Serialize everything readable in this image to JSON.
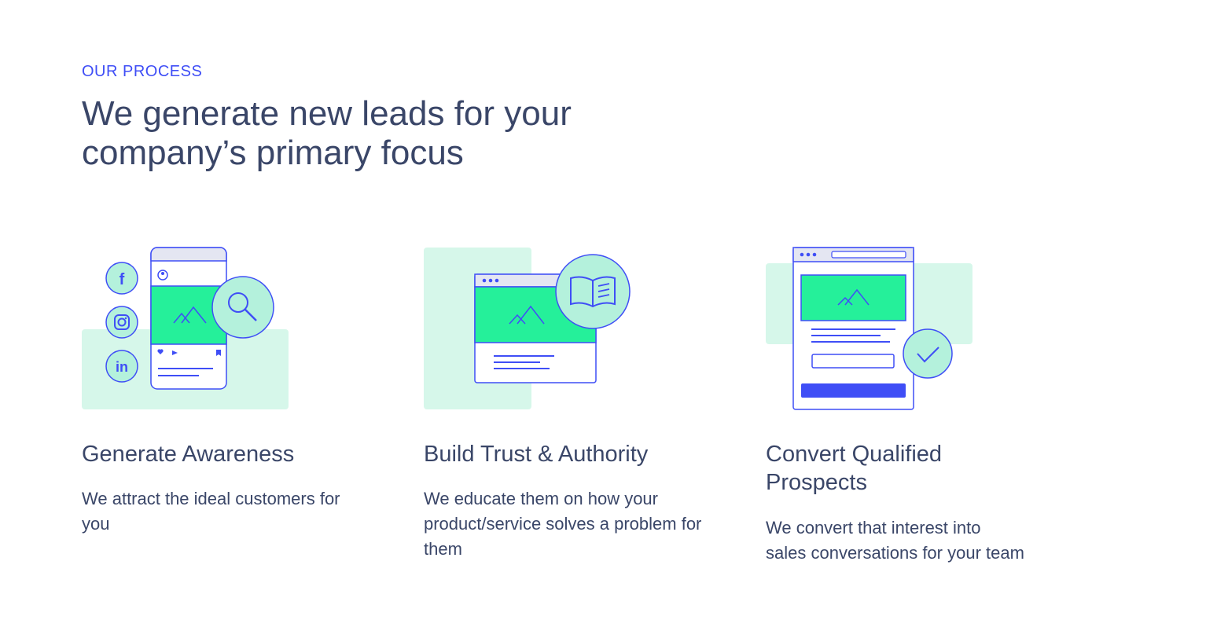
{
  "section": {
    "eyebrow": "OUR PROCESS",
    "headline": "We generate new leads for your company’s primary focus"
  },
  "cards": [
    {
      "title": "Generate Awareness",
      "description": "We attract the ideal customers for you",
      "illustration_icons": [
        "facebook-icon",
        "instagram-icon",
        "linkedin-icon",
        "phone-post-icon",
        "magnifier-icon"
      ]
    },
    {
      "title": "Build Trust & Authority",
      "description": "We educate them on how your product/service solves a problem for them",
      "illustration_icons": [
        "browser-window-icon",
        "open-book-icon"
      ]
    },
    {
      "title": "Convert Qualified Prospects",
      "description": "We convert that interest into sales conversations for your team",
      "illustration_icons": [
        "landing-page-icon",
        "checkmark-icon"
      ]
    }
  ],
  "colors": {
    "accent": "#3f4ef6",
    "text": "#3a4668",
    "mint_bg": "#d6f7ea",
    "green_fill": "#25f09a",
    "circle_fill": "#b4f1dc",
    "bar_fill": "#e4e6f2"
  }
}
